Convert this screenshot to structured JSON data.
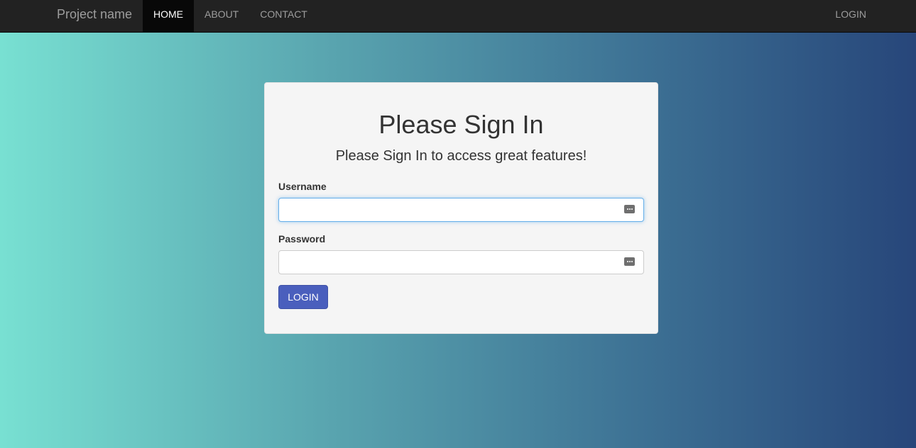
{
  "navbar": {
    "brand": "Project name",
    "links": [
      {
        "label": "HOME",
        "active": true
      },
      {
        "label": "ABOUT",
        "active": false
      },
      {
        "label": "CONTACT",
        "active": false
      }
    ],
    "right_link": "LOGIN"
  },
  "login_card": {
    "title": "Please Sign In",
    "subtitle": "Please Sign In to access great features!",
    "username_label": "Username",
    "username_value": "",
    "password_label": "Password",
    "password_value": "",
    "submit_label": "LOGIN"
  },
  "colors": {
    "navbar_bg": "#222222",
    "button_bg": "#4a5fbd",
    "gradient_start": "#78e0d2",
    "gradient_end": "#27467a"
  },
  "icons": {
    "username_field_icon": "password-manager-icon",
    "password_field_icon": "password-manager-icon"
  }
}
